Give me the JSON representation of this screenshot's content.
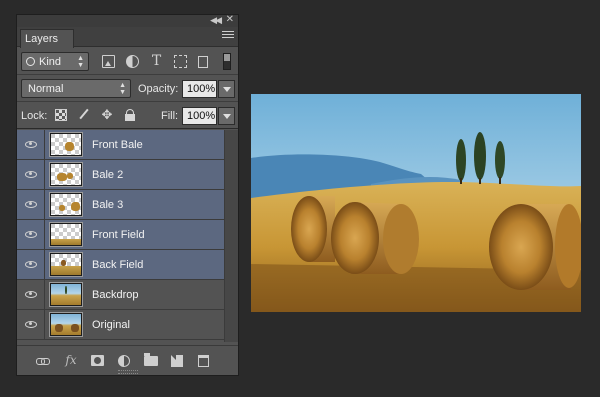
{
  "panel": {
    "tab_label": "Layers",
    "filter": {
      "kind_label": "Kind"
    },
    "blend": {
      "mode": "Normal",
      "opacity_label": "Opacity:",
      "opacity_value": "100%"
    },
    "lock": {
      "lock_label": "Lock:",
      "fill_label": "Fill:",
      "fill_value": "100%"
    },
    "layers": [
      {
        "name": "Front Bale",
        "selected": true
      },
      {
        "name": "Bale 2",
        "selected": true
      },
      {
        "name": "Bale 3",
        "selected": true
      },
      {
        "name": "Front Field",
        "selected": true
      },
      {
        "name": "Back Field",
        "selected": true
      },
      {
        "name": "Backdrop",
        "selected": false
      },
      {
        "name": "Original",
        "selected": false
      }
    ]
  },
  "colors": {
    "panel_bg": "#535353",
    "selection": "#5c6880",
    "app_bg": "#2a2a2a"
  }
}
